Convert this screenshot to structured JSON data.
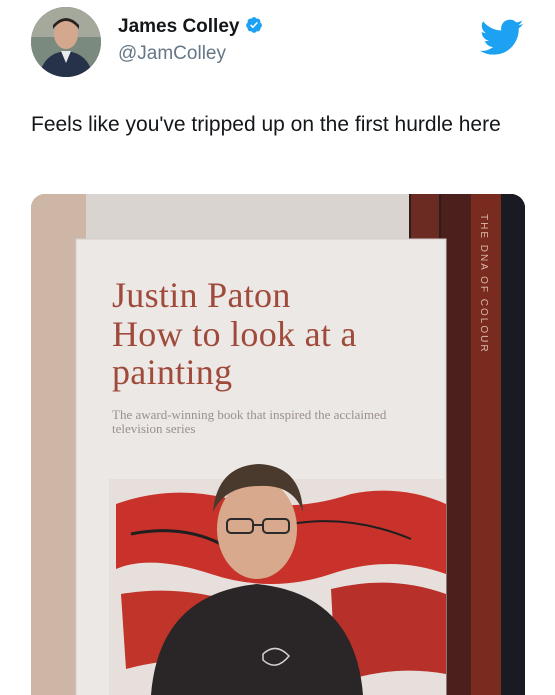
{
  "tweet": {
    "author_name": "James Colley",
    "author_handle": "@JamColley",
    "verified": true,
    "text": "Feels like you've tripped up on the first hurdle here",
    "icon_names": [
      "avatar",
      "verified-badge-icon",
      "twitter-bird-icon"
    ],
    "colors": {
      "verified": "#1da1f2",
      "bird": "#1da1f2",
      "handle": "#657786",
      "text": "#14171a"
    }
  },
  "photo": {
    "book_author": "Justin Paton",
    "book_title": "How to look at a painting",
    "book_tagline": "The award-winning book that inspired the acclaimed television series",
    "spine_text": "THE DNA OF COLOUR"
  }
}
